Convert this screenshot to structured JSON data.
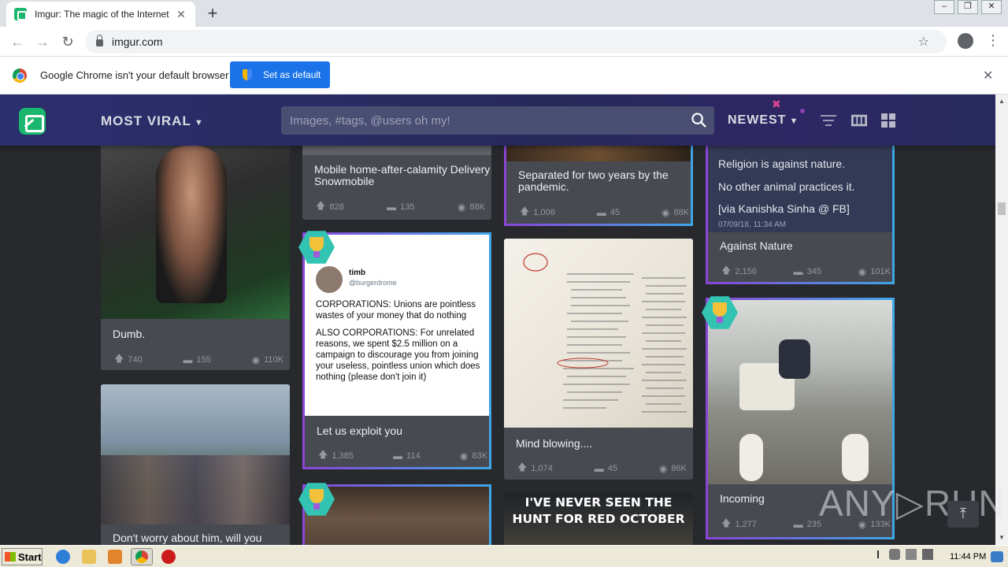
{
  "browser": {
    "tab_title": "Imgur: The magic of the Internet",
    "tab_close": "✕",
    "new_tab": "+",
    "url": "imgur.com",
    "infobar_message": "Google Chrome isn't your default browser",
    "set_default_label": "Set as default",
    "infobar_close": "✕"
  },
  "header": {
    "section_label": "MOST VIRAL",
    "search_placeholder": "Images, #tags, @users oh my!",
    "sort_label": "NEWEST"
  },
  "posts": [
    {
      "title": "Dumb.",
      "upvotes": "740",
      "comments": "155",
      "views": "110K"
    },
    {
      "title": "Don't worry about him, will you"
    },
    {
      "title": "Mobile home-after-calamity Delivery Snowmobile",
      "upvotes": "828",
      "comments": "135",
      "views": "88K"
    },
    {
      "title": "Let us exploit you",
      "upvotes": "1,385",
      "comments": "114",
      "views": "83K",
      "tweet": {
        "name": "timb",
        "handle": "@burgerdrome",
        "p1": "CORPORATIONS: Unions are pointless wastes of your money that do nothing",
        "p2": "ALSO CORPORATIONS: For unrelated reasons, we spent $2.5 million on a campaign to discourage you from joining your useless, pointless union which does nothing (please don't join it)"
      }
    },
    {
      "title": "Separated for two years by the pandemic.",
      "upvotes": "1,006",
      "comments": "45",
      "views": "88K"
    },
    {
      "title": "Mind blowing....",
      "upvotes": "1,074",
      "comments": "45",
      "views": "86K"
    },
    {
      "title": "",
      "meme_text": "I'VE NEVER SEEN THE HUNT FOR RED OCTOBER"
    },
    {
      "title": "Against Nature",
      "upvotes": "2,156",
      "comments": "345",
      "views": "101K",
      "quote_l1": "Religion is against nature.",
      "quote_l2": "No other animal practices it.",
      "quote_l3": "[via Kanishka Sinha @ FB]",
      "date": "07/09/18, 11:34 AM"
    },
    {
      "title": "Incoming",
      "upvotes": "1,277",
      "comments": "235",
      "views": "133K"
    }
  ],
  "watermark": "ANY▷RUN",
  "taskbar": {
    "start_label": "Start",
    "clock": "11:44 PM"
  },
  "icons": {
    "upvote": "arrow-up-icon",
    "comment": "comment-icon",
    "views": "eye-icon"
  }
}
